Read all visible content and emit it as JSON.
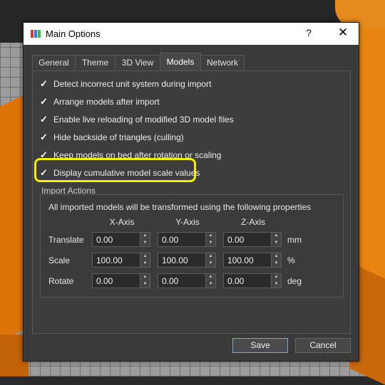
{
  "dialog": {
    "title": "Main Options",
    "help_glyph": "?",
    "close_glyph": "✕",
    "app_icon_colors": [
      "#e0362c",
      "#2c7fe0",
      "#3cbf3c"
    ]
  },
  "tabs": [
    {
      "label": "General",
      "active": false
    },
    {
      "label": "Theme",
      "active": false
    },
    {
      "label": "3D View",
      "active": false
    },
    {
      "label": "Models",
      "active": true
    },
    {
      "label": "Network",
      "active": false
    }
  ],
  "options": [
    {
      "label": "Detect incorrect unit system during import",
      "checked": true
    },
    {
      "label": "Arrange models after import",
      "checked": true
    },
    {
      "label": "Enable live reloading of modified 3D model files",
      "checked": true
    },
    {
      "label": "Hide backside of triangles (culling)",
      "checked": true
    },
    {
      "label": "Keep models on bed after rotation or scaling",
      "checked": true
    },
    {
      "label": "Display cumulative model scale values",
      "checked": true
    }
  ],
  "check_glyph": "✓",
  "highlight_color": "#f2f000",
  "import_actions": {
    "group_label": "Import Actions",
    "description": "All imported models will be transformed using the following properties",
    "axes": [
      "X-Axis",
      "Y-Axis",
      "Z-Axis"
    ],
    "rows": [
      {
        "label": "Translate",
        "values": [
          "0.00",
          "0.00",
          "0.00"
        ],
        "unit": "mm"
      },
      {
        "label": "Scale",
        "values": [
          "100.00",
          "100.00",
          "100.00"
        ],
        "unit": "%"
      },
      {
        "label": "Rotate",
        "values": [
          "0.00",
          "0.00",
          "0.00"
        ],
        "unit": "deg"
      }
    ]
  },
  "buttons": {
    "save": "Save",
    "cancel": "Cancel"
  }
}
